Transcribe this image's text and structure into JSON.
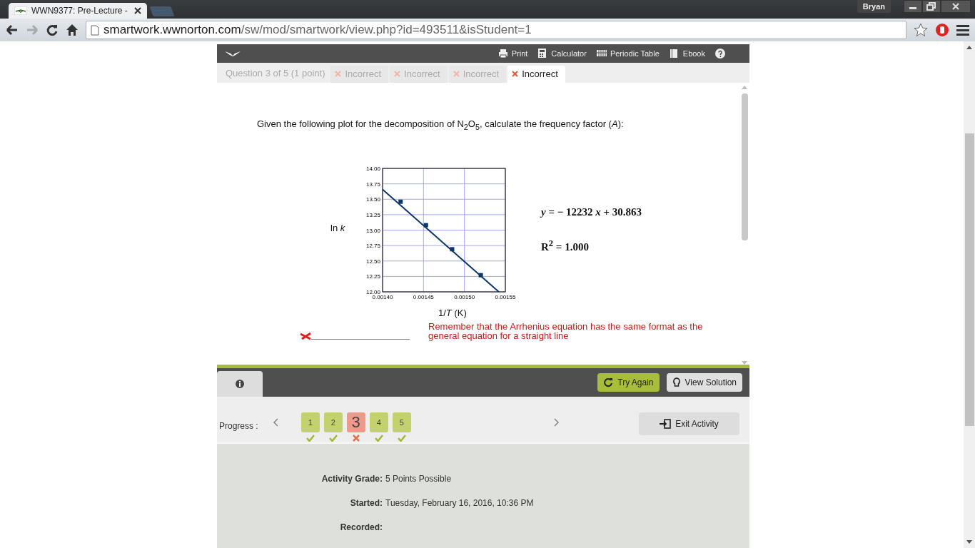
{
  "browser": {
    "tab_title": "WWN9377: Pre-Lecture - ",
    "user": "Bryan",
    "url_host": "smartwork.wwnorton.com",
    "url_path": "/sw/mod/smartwork/view.php?id=493511&isStudent=1"
  },
  "toolbar": {
    "items": [
      {
        "kind": "print",
        "label": "Print"
      },
      {
        "kind": "calculator",
        "label": "Calculator"
      },
      {
        "kind": "table",
        "label": "Periodic Table"
      },
      {
        "kind": "book",
        "label": "Ebook"
      }
    ]
  },
  "question_tabs": {
    "label": "Question 3 of 5 (1 point)",
    "attempts": [
      {
        "label": "Incorrect",
        "selected": false
      },
      {
        "label": "Incorrect",
        "selected": false
      },
      {
        "label": "Incorrect",
        "selected": false
      },
      {
        "label": "Incorrect",
        "selected": true
      }
    ]
  },
  "question": {
    "prompt": "Given the following plot for the decomposition of N$_{2}$O$_{5}$, calculate the frequency factor (*A*):",
    "chart_data": {
      "type": "scatter",
      "xlabel": "1/*T* (K)",
      "ylabel": "ln *k*",
      "grid": true,
      "xlim": [
        0.0014,
        0.00155
      ],
      "ylim": [
        12,
        14
      ],
      "xticks": [
        {
          "value": 0.0014,
          "label": "0.00140"
        },
        {
          "value": 0.00145,
          "label": "0.00145"
        },
        {
          "value": 0.0015,
          "label": "0.00150"
        },
        {
          "value": 0.00155,
          "label": "0.00155"
        }
      ],
      "yticks": [
        {
          "value": 12,
          "label": "12.00"
        },
        {
          "value": 12.25,
          "label": "12.25"
        },
        {
          "value": 12.5,
          "label": "12.50"
        },
        {
          "value": 12.75,
          "label": "12.75"
        },
        {
          "value": 13,
          "label": "13.00"
        },
        {
          "value": 13.25,
          "label": "13.25"
        },
        {
          "value": 13.5,
          "label": "13.50"
        },
        {
          "value": 13.75,
          "label": "13.75"
        },
        {
          "value": 14,
          "label": "14.00"
        }
      ],
      "series": [
        {
          "color": "#0d3766",
          "x": [
            0.001422,
            0.001453,
            0.001485,
            0.00152
          ],
          "values": [
            13.46,
            13.08,
            12.69,
            12.27
          ]
        },
        {
          "type": "line",
          "color": "#0d3766",
          "x": [
            0.0014,
            0.001542
          ],
          "values": [
            13.66,
            12.0
          ]
        }
      ],
      "annotations": [
        "*y* = − 12232 *x* + 30.863",
        "R$^{2}$ = 1.000"
      ]
    },
    "hint": "Remember that the Arrhenius equation has the same format as the general equation for a straight line",
    "answer": {
      "correct": false
    }
  },
  "actions": [
    {
      "kind": "retry",
      "label": "Try Again"
    },
    {
      "kind": "solution",
      "label": "View Solution"
    }
  ],
  "progress": {
    "label": "Progress :",
    "items": [
      {
        "label": "1",
        "correct": true,
        "selected": false
      },
      {
        "label": "2",
        "correct": true,
        "selected": false
      },
      {
        "label": "3",
        "correct": false,
        "selected": true
      },
      {
        "label": "4",
        "correct": true,
        "selected": false
      },
      {
        "label": "5",
        "correct": true,
        "selected": false
      }
    ],
    "exit": "Exit Activity"
  },
  "grade": [
    {
      "label": "Activity Grade:",
      "value": "5 Points Possible"
    },
    {
      "label": "Started:",
      "value": "Tuesday, February 16, 2016, 10:36 PM"
    },
    {
      "label": "Recorded:"
    }
  ]
}
